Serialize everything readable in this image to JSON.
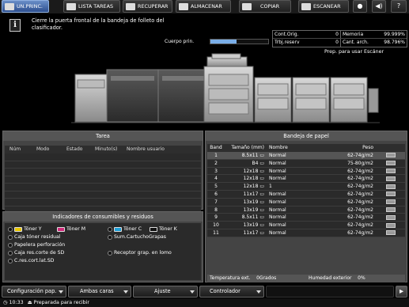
{
  "tabs": [
    {
      "label": "UN.PRINC.",
      "active": true
    },
    {
      "label": "LISTA TAREAS",
      "active": false
    },
    {
      "label": "RECUPERAR",
      "active": false
    },
    {
      "label": "ALMACENAR",
      "active": false
    },
    {
      "label": "COPIAR",
      "active": false
    },
    {
      "label": "ESCANEAR",
      "active": false
    }
  ],
  "top_icons": [
    "globe-icon",
    "volume-icon",
    "help-icon"
  ],
  "help_glyph": "?",
  "message": {
    "icon_glyph": "i",
    "text": "Cierre la puerta frontal de la bandeja de folleto del clasificador."
  },
  "cuerpo": {
    "label": "Cuerpo prin.",
    "level": 0.45
  },
  "counters": [
    {
      "label": "Cont.Orig.",
      "value": "0",
      "label2": "Memoria",
      "value2": "99.999%"
    },
    {
      "label": "Trbj.reserv",
      "value": "0",
      "label2": "Cant. arch.",
      "value2": "98.796%"
    }
  ],
  "status_right": "Prep. para usar Escáner",
  "tarea": {
    "title": "Tarea",
    "columns": [
      "Núm",
      "Modo",
      "Estado",
      "Minuto(s)",
      "Nombre usuario"
    ],
    "row_count": 10
  },
  "consumibles": {
    "title": "Indicadores de consumibles y residuos",
    "toners": [
      "Tóner Y",
      "Tóner M",
      "Tóner C",
      "Tóner K"
    ],
    "items": [
      "Caja tóner residual",
      "Sum.CartuchoGrapas",
      "Papelera perforación",
      "Caja res.corte de SD",
      "Receptor grap. en lomo",
      "C.res.cort.lat.SD"
    ]
  },
  "bandeja": {
    "title": "Bandeja de papel",
    "columns": [
      "Band",
      "Tamaño (mm)",
      "Nombre",
      "Peso"
    ],
    "rows": [
      {
        "band": "1",
        "size": "8.5x11",
        "name": "Normal",
        "peso": "62-74g/m2",
        "level": 1.0
      },
      {
        "band": "2",
        "size": "B4",
        "name": "Normal",
        "peso": "75-80g/m2",
        "level": 1.0
      },
      {
        "band": "3",
        "size": "12x18",
        "name": "Normal",
        "peso": "62-74g/m2",
        "level": 1.0
      },
      {
        "band": "4",
        "size": "12x18",
        "name": "Normal",
        "peso": "62-74g/m2",
        "level": 1.0
      },
      {
        "band": "5",
        "size": "12x18",
        "name": "1",
        "peso": "62-74g/m2",
        "level": 1.0
      },
      {
        "band": "6",
        "size": "11x17",
        "name": "Normal",
        "peso": "62-74g/m2",
        "level": 1.0
      },
      {
        "band": "7",
        "size": "13x19",
        "name": "Normal",
        "peso": "62-74g/m2",
        "level": 1.0
      },
      {
        "band": "8",
        "size": "13x19",
        "name": "Normal",
        "peso": "62-74g/m2",
        "level": 1.0
      },
      {
        "band": "9",
        "size": "8.5x11",
        "name": "Normal",
        "peso": "62-74g/m2",
        "level": 1.0
      },
      {
        "band": "10",
        "size": "13x19",
        "name": "Normal",
        "peso": "62-74g/m2",
        "level": 1.0
      },
      {
        "band": "11",
        "size": "11x17",
        "name": "Normal",
        "peso": "62-74g/m2",
        "level": 1.0
      }
    ],
    "footer": [
      {
        "label": "Temperatura ext.",
        "value": "0Grados"
      },
      {
        "label": "Humedad exterior",
        "value": "0%"
      }
    ]
  },
  "bottom": [
    "Configuración pap.",
    "Ambas caras",
    "Ajuste",
    "Controlador"
  ],
  "statusbar": {
    "time": "10:33",
    "text": "Preparada para recibir"
  }
}
